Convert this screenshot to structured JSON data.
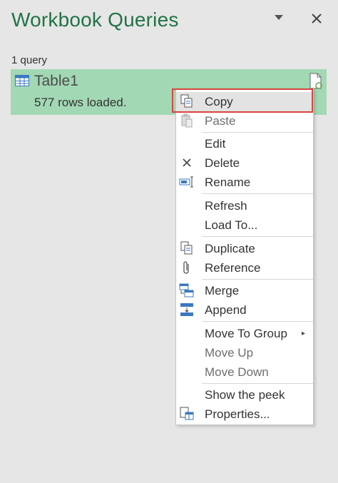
{
  "pane": {
    "title": "Workbook Queries",
    "count_label": "1 query"
  },
  "query": {
    "name": "Table1",
    "status": "577 rows loaded."
  },
  "context_menu": {
    "copy": "Copy",
    "paste": "Paste",
    "edit": "Edit",
    "delete": "Delete",
    "rename": "Rename",
    "refresh": "Refresh",
    "load_to": "Load To...",
    "duplicate": "Duplicate",
    "reference": "Reference",
    "merge": "Merge",
    "append": "Append",
    "move_to_group": "Move To Group",
    "move_up": "Move Up",
    "move_down": "Move Down",
    "show_the_peek": "Show the peek",
    "properties": "Properties..."
  },
  "colors": {
    "accent": "#217346",
    "selected_query_bg": "#a2d8b4",
    "highlight_outline": "#d9443d"
  }
}
